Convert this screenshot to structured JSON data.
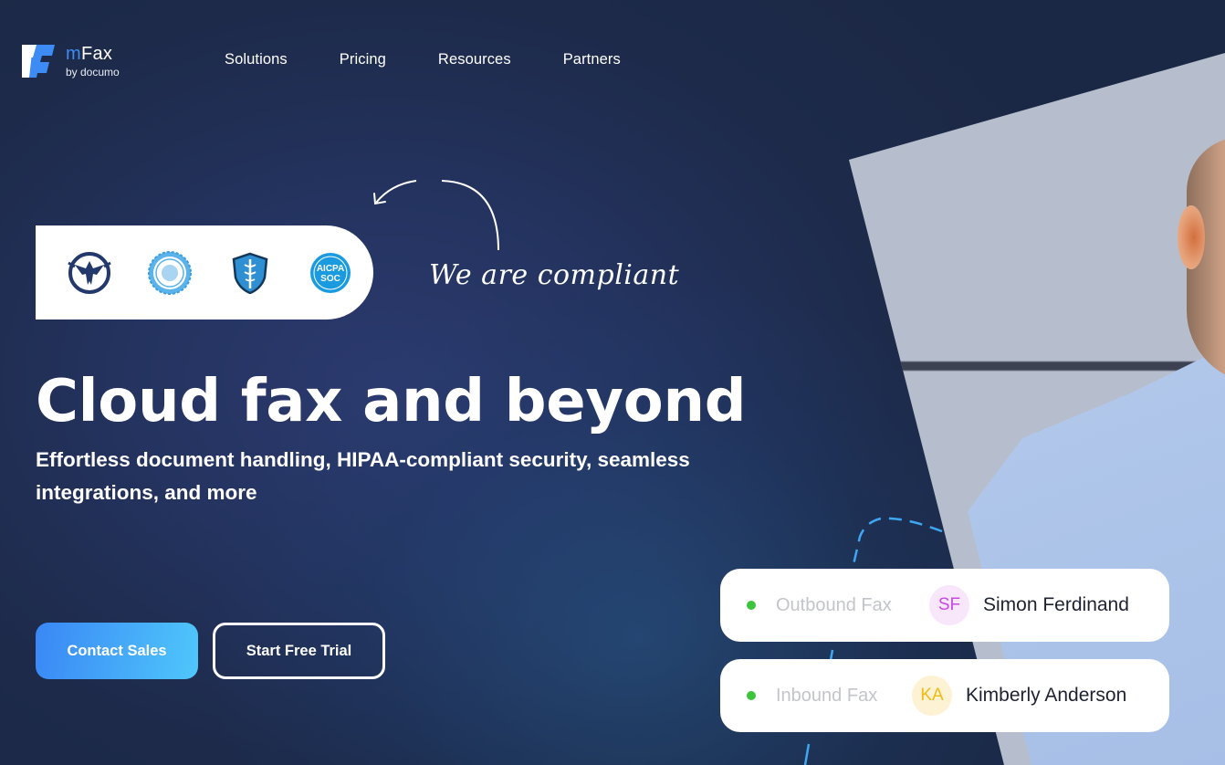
{
  "header": {
    "logo": {
      "brand_prefix": "m",
      "brand_suffix": "Fax",
      "byline": "by documo",
      "icon": "mfax-logo-icon"
    },
    "nav": [
      {
        "label": "Solutions"
      },
      {
        "label": "Pricing"
      },
      {
        "label": "Resources"
      },
      {
        "label": "Partners"
      }
    ]
  },
  "compliance": {
    "badges": [
      {
        "name": "eagle-compliance-badge-icon"
      },
      {
        "name": "seal-compliance-badge-icon"
      },
      {
        "name": "hipaa-shield-badge-icon"
      },
      {
        "name": "aicpa-soc-badge-icon",
        "text_top": "AICPA",
        "text_bottom": "SOC"
      }
    ],
    "callout": "We are compliant"
  },
  "hero": {
    "title": "Cloud fax and beyond",
    "subtitle": "Effortless document handling, HIPAA-compliant security, seamless integrations, and more"
  },
  "buttons": {
    "primary": "Contact Sales",
    "secondary": "Start Free Trial"
  },
  "fax_cards": [
    {
      "type": "Outbound Fax",
      "initials": "SF",
      "name": "Simon Ferdinand",
      "status_color": "#3cc43c",
      "avatar_bg": "#f8e6fb",
      "avatar_fg": "#c94ae0"
    },
    {
      "type": "Inbound Fax",
      "initials": "KA",
      "name": "Kimberly Anderson",
      "status_color": "#3cc43c",
      "avatar_bg": "#fdf2d4",
      "avatar_fg": "#f2bb13"
    }
  ],
  "colors": {
    "accent_blue": "#3a87f5",
    "accent_cyan": "#4fc7fb",
    "background_navy": "#1d2a4a"
  }
}
